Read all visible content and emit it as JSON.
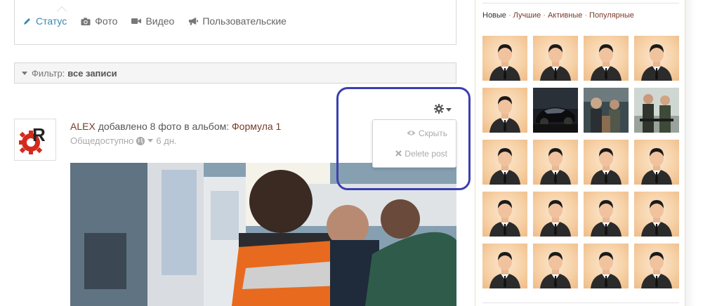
{
  "composer": {
    "tabs": [
      {
        "label": "Статус",
        "icon": "pencil-icon",
        "active": true
      },
      {
        "label": "Фото",
        "icon": "camera-icon",
        "active": false
      },
      {
        "label": "Видео",
        "icon": "video-camera-icon",
        "active": false
      },
      {
        "label": "Пользовательские",
        "icon": "bullhorn-icon",
        "active": false
      }
    ]
  },
  "filter": {
    "label": "Фильтр:",
    "value": "все записи"
  },
  "post": {
    "author": "ALEX",
    "action_text": "добавлено 8 фото в альбом:",
    "album": "Формула 1",
    "privacy": "Общедоступно",
    "time": "6 дн.",
    "avatar_letter": "R"
  },
  "post_menu": {
    "hide_label": "Скрыть",
    "delete_label": "Delete post"
  },
  "sidebar": {
    "sort_links": [
      {
        "label": "Новые",
        "current": true
      },
      {
        "label": "Лучшие",
        "current": false
      },
      {
        "label": "Активные",
        "current": false
      },
      {
        "label": "Популярные",
        "current": false
      }
    ],
    "tiles": [
      "person",
      "person",
      "person",
      "person",
      "person",
      "car",
      "game-art",
      "game-art-2",
      "person",
      "person",
      "person",
      "person",
      "person",
      "person",
      "person",
      "person",
      "person",
      "person",
      "person",
      "person"
    ]
  },
  "colors": {
    "accent_link": "#3a87ad",
    "brand_link": "#7a3a28",
    "highlight": "#3b3fb0",
    "avatar_red": "#d42a1e"
  }
}
